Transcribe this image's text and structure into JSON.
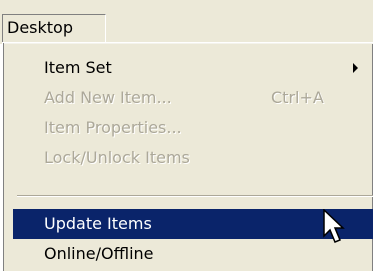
{
  "menubar": {
    "desktop_label": "Desktop"
  },
  "menu": {
    "items": [
      {
        "label": "Item Set",
        "shortcut": "",
        "enabled": true,
        "has_submenu": true
      },
      {
        "label": "Add New Item...",
        "shortcut": "Ctrl+A",
        "enabled": false
      },
      {
        "label": "Item Properties...",
        "shortcut": "",
        "enabled": false
      },
      {
        "label": "Lock/Unlock Items",
        "shortcut": "",
        "enabled": false
      },
      {
        "label": "Update Items",
        "shortcut": "",
        "enabled": true,
        "highlighted": true
      },
      {
        "label": "Online/Offline",
        "shortcut": "",
        "enabled": true
      }
    ]
  },
  "colors": {
    "menu_background": "#ece9d8",
    "highlight_background": "#0a246a",
    "disabled_text": "#aca899"
  },
  "icons": {
    "submenu": "submenu-arrow-icon",
    "cursor": "mouse-pointer-icon"
  }
}
